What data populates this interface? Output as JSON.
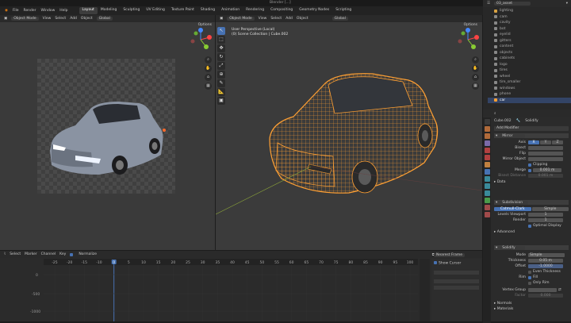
{
  "window": {
    "title": "Blender [...]"
  },
  "menu": [
    "File",
    "Render",
    "Window",
    "Help"
  ],
  "workspaces": [
    "Layout",
    "Modeling",
    "Sculpting",
    "UV Editing",
    "Texture Paint",
    "Shading",
    "Animation",
    "Rendering",
    "Compositing",
    "Geometry Nodes",
    "Scripting"
  ],
  "active_workspace": "Layout",
  "scene": {
    "name": "Scene",
    "view_layer": "ViewLayer",
    "search_value": "03_asset"
  },
  "left_viewport": {
    "mode": "Object Mode",
    "menus": [
      "View",
      "Select",
      "Add",
      "Object"
    ],
    "orientation": "Global",
    "options": "Options"
  },
  "main_viewport": {
    "mode": "Object Mode",
    "menus": [
      "View",
      "Select",
      "Add",
      "Object"
    ],
    "orientation": "Global",
    "options": "Options",
    "overlay_line1": "User Perspective (Local)",
    "overlay_line2": "(0) Scene Collection | Cube.002"
  },
  "tools": [
    "cursor",
    "select-box",
    "move",
    "rotate",
    "scale",
    "transform",
    "annotate",
    "measure",
    "add-cube"
  ],
  "outliner": {
    "items": [
      "lighting",
      "cam",
      "cavity",
      "bot",
      "eyelid",
      "gitters",
      "content",
      "objects",
      "cabinets",
      "logo",
      "tires",
      "wheel",
      "tire_smaller",
      "windows",
      "phone",
      "car"
    ]
  },
  "properties": {
    "object_name": "Cube.002",
    "modifier_name": "Solidify",
    "add_modifier": "Add Modifier",
    "mirror": {
      "name": "Mirror",
      "axis_label": "Axis",
      "bisect_label": "Bisect",
      "flip_label": "Flip",
      "axes": [
        "X",
        "Y",
        "Z"
      ],
      "mirror_object_label": "Mirror Object",
      "clipping_label": "Clipping",
      "merge_label": "Merge",
      "merge_value": "0.001 m",
      "bisect_distance_label": "Bisect Distance",
      "bisect_distance_value": "0.001 m",
      "data_label": "Data"
    },
    "subdivision": {
      "name": "Subdivision",
      "catmull": "Catmull-Clark",
      "simple": "Simple",
      "levels_viewport_label": "Levels Viewport",
      "levels_viewport_value": "1",
      "render_label": "Render",
      "render_value": "1",
      "optimal_display": "Optimal Display",
      "advanced_label": "Advanced"
    },
    "solidify": {
      "name": "Solidify",
      "mode_label": "Mode",
      "mode_value": "Simple",
      "thickness_label": "Thickness",
      "thickness_value": "0.05 m",
      "offset_label": "Offset",
      "offset_value": "-1.0000",
      "even_thickness": "Even Thickness",
      "rim_label": "Rim",
      "fill": "Fill",
      "only_rim": "Only Rim",
      "vertex_group_label": "Vertex Group",
      "factor_label": "Factor",
      "factor_value": "0.000",
      "normals_label": "Normals",
      "materials_label": "Materials"
    }
  },
  "timeline": {
    "menus": [
      "Select",
      "Marker",
      "Channel",
      "Key"
    ],
    "normalize": "Normalize",
    "frame_labels": [
      "-25",
      "-20",
      "-15",
      "-10",
      "0",
      "5",
      "10",
      "15",
      "20",
      "25",
      "30",
      "35",
      "40",
      "45",
      "50",
      "55",
      "60",
      "65",
      "70",
      "75",
      "80",
      "85",
      "90",
      "95",
      "100"
    ],
    "current_frame": "0",
    "value_labels": [
      "0",
      "-500",
      "-1000"
    ],
    "interp": "Nearest Frame",
    "show_cursor": "Show Cursor"
  },
  "colors": {
    "accent": "#4772b3",
    "selection": "#ffa033",
    "timeline_cursor": "#4772b3"
  }
}
